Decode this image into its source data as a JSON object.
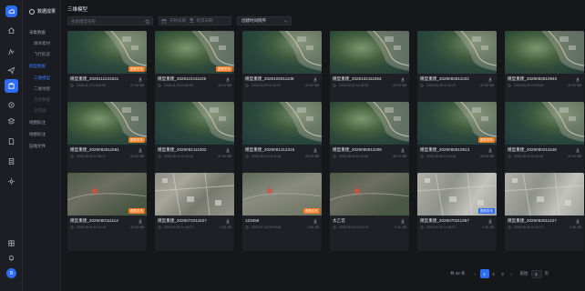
{
  "sidebar": {
    "header": "数据成果",
    "items": [
      {
        "label": "采集数据"
      },
      {
        "label": "媒体素材"
      },
      {
        "label": "飞行航迹"
      },
      {
        "label": "模型数据"
      },
      {
        "label": "三维模型"
      },
      {
        "label": "二维地图"
      },
      {
        "label": "点云数据"
      },
      {
        "label": "全景图"
      },
      {
        "label": "地图标注"
      },
      {
        "label": "地图标注"
      },
      {
        "label": "压缩文件"
      }
    ],
    "avatar_letter": "B"
  },
  "page": {
    "title": "三维模型",
    "search_placeholder": "搜索模型名称",
    "date_start_placeholder": "开始日期",
    "date_sep": "至",
    "date_end_placeholder": "结束日期",
    "sort_label": "创建时间倒序"
  },
  "cards": [
    {
      "name": "模型重建_2025111131631",
      "time": "2025-11-13 16:32:50",
      "size": "27.56 MB",
      "badge": "图斑发布",
      "badge_color": "orange"
    },
    {
      "name": "模型重建_2025110411105",
      "time": "2025-11-04 11:05:05",
      "size": "46.13 MB",
      "badge": "图斑发布",
      "badge_color": "orange"
    },
    {
      "name": "模型重建_2025102911108",
      "time": "2025-10-29 11:10:51",
      "size": "32.62 MB",
      "badge": "",
      "badge_color": ""
    },
    {
      "name": "模型重建_2025102111053",
      "time": "2025-10-21 11:05:33",
      "size": "32.03 MB",
      "badge": "",
      "badge_color": ""
    },
    {
      "name": "模型重建_2025092811022",
      "time": "2025-09-28 11:02:23",
      "size": "31.98 MB",
      "badge": "",
      "badge_color": ""
    },
    {
      "name": "模型重建_2025092610940",
      "time": "2025-09-26 10:09:40",
      "size": "32.90 MB",
      "badge": "",
      "badge_color": ""
    },
    {
      "name": "模型重建_2025082611551",
      "time": "2025-08-26 11:55:21",
      "size": "39.52 MB",
      "badge": "图斑发布",
      "badge_color": "orange"
    },
    {
      "name": "模型重建_2025082111002",
      "time": "2025-08-21 11:00:23",
      "size": "37.30 MB",
      "badge": "",
      "badge_color": ""
    },
    {
      "name": "模型重建_2025081312316",
      "time": "2025-08-13 12:31:40",
      "size": "28.18 MB",
      "badge": "",
      "badge_color": ""
    },
    {
      "name": "模型重建_2025080911009",
      "time": "2025-08-09 11:00:09",
      "size": "38.72 MB",
      "badge": "",
      "badge_color": ""
    },
    {
      "name": "模型重建_2025080610913",
      "time": "2025-08-06 10:13:40",
      "size": "33.06 MB",
      "badge": "图斑发布",
      "badge_color": "orange"
    },
    {
      "name": "模型重建_2025080211548",
      "time": "2025-08-02 11:54:49",
      "size": "30.94 MB",
      "badge": "",
      "badge_color": ""
    },
    {
      "name": "模型重建_2025080111114",
      "time": "2025-08-01 11:11:14",
      "size": "40.52 MB",
      "badge": "图斑发布",
      "badge_color": "orange"
    },
    {
      "name": "模型重建_2025072011627",
      "time": "2025-07-20 11:16:27",
      "size": "1.22 GB",
      "badge": "",
      "badge_color": ""
    },
    {
      "name": "123456",
      "time": "2025-07-15 09:15:04",
      "size": "1.65 GB",
      "badge": "图斑发布",
      "badge_color": "orange"
    },
    {
      "name": "太乙宫",
      "time": "2025-06-03 15:20:07",
      "size": "3.41 GB",
      "badge": "",
      "badge_color": ""
    },
    {
      "name": "模型重建_2025070311357",
      "time": "2025-07-03 11:35:07",
      "size": "1.45 GB",
      "badge": "图斑发布",
      "badge_color": "blue"
    },
    {
      "name": "模型重建_2025063011427",
      "time": "2025-06-30 11:42:27",
      "size": "2.98 GB",
      "badge": "",
      "badge_color": ""
    }
  ],
  "pagination": {
    "total_label": "共 42 条",
    "prev": "‹",
    "pages": [
      "1",
      "2",
      "3"
    ],
    "next": "›",
    "goto_label": "前往",
    "goto_value": "1",
    "page_unit": "页"
  },
  "colors": {
    "accent": "#2d6cf5",
    "badge_orange": "#f07a1c"
  }
}
